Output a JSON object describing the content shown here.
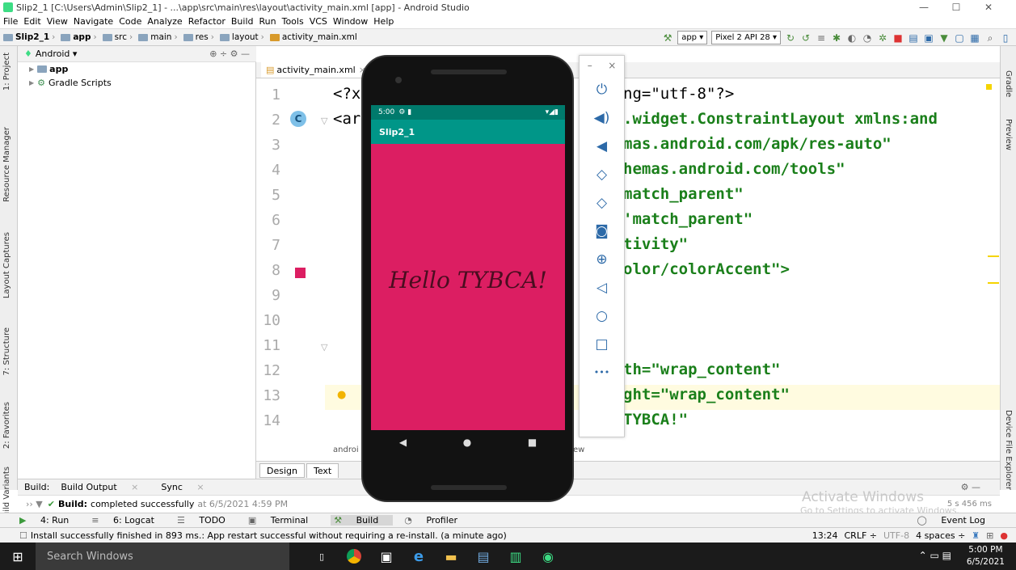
{
  "window": {
    "title": "Slip2_1 [C:\\Users\\Admin\\Slip2_1] - ...\\app\\src\\main\\res\\layout\\activity_main.xml [app] - Android Studio",
    "min": "—",
    "max": "☐",
    "close": "✕"
  },
  "menu": [
    "File",
    "Edit",
    "View",
    "Navigate",
    "Code",
    "Analyze",
    "Refactor",
    "Build",
    "Run",
    "Tools",
    "VCS",
    "Window",
    "Help"
  ],
  "breadcrumbs": [
    "Slip2_1",
    "app",
    "src",
    "main",
    "res",
    "layout",
    "activity_main.xml"
  ],
  "toolbar": {
    "run_config": "app ▾",
    "device": "Pixel 2 API 28 ▾"
  },
  "left_tabs": [
    "1: Project",
    "Resource Manager",
    "Layout Captures",
    "7: Structure",
    "2: Favorites",
    "Build Variants"
  ],
  "right_tabs": [
    "Gradle",
    "Preview",
    "Device File Explorer"
  ],
  "project": {
    "view_selector": "Android ▾",
    "items": [
      "app",
      "Gradle Scripts"
    ]
  },
  "editor": {
    "tab": "activity_main.xml",
    "line_numbers": [
      "1",
      "2",
      "3",
      "4",
      "5",
      "6",
      "7",
      "8",
      "9",
      "10",
      "11",
      "12",
      "13",
      "14"
    ],
    "visible_code": [
      "<?x",
      "<ar",
      "",
      "",
      "",
      "",
      "",
      "",
      "",
      "",
      "",
      "",
      "",
      ""
    ],
    "visible_code_right": [
      "ng=\"utf-8\"?>",
      ".widget.ConstraintLayout xmlns:and",
      "mas.android.com/apk/res-auto\"",
      "hemas.android.com/tools\"",
      "match_parent\"",
      "'match_parent\"",
      "tivity\"",
      "olor/colorAccent\">",
      "",
      "",
      "",
      "th=\"wrap_content\"",
      "ght=\"wrap_content\"",
      "TYBCA!\""
    ],
    "bottom_fragment_left": "androi",
    "bottom_fragment_right": "ew",
    "design_tab": "Design",
    "text_tab": "Text",
    "gutter_badge": "C"
  },
  "build": {
    "label": "Build:",
    "tab_output": "Build Output",
    "tab_sync": "Sync",
    "status_bold": "Build:",
    "status_text": "completed successfully",
    "status_time": "at 6/5/2021 4:59 PM",
    "duration": "5 s 456 ms"
  },
  "watermark": {
    "line1": "Activate Windows",
    "line2": "Go to Settings to activate Windows."
  },
  "tool_windows": [
    "4: Run",
    "6: Logcat",
    "TODO",
    "Terminal",
    "Build",
    "Profiler"
  ],
  "event_log": "Event Log",
  "status": {
    "message": "Install successfully finished in 893 ms.: App restart successful without requiring a re-install. (a minute ago)",
    "position": "13:24",
    "line_sep": "CRLF ÷",
    "encoding": "UTF-8",
    "indent": "4 spaces ÷"
  },
  "emulator": {
    "time": "5:00",
    "app_title": "Slip2_1",
    "hello_text": "Hello TYBCA!",
    "panel_min": "–",
    "panel_close": "×",
    "more": "•••"
  },
  "taskbar": {
    "search": "Search Windows",
    "time": "5:00 PM",
    "date": "6/5/2021"
  },
  "colors": {
    "screen_bg": "#dc1e62",
    "appbar": "#009688",
    "status_bar": "#007a6c",
    "attr_green": "#1a7f1a"
  }
}
